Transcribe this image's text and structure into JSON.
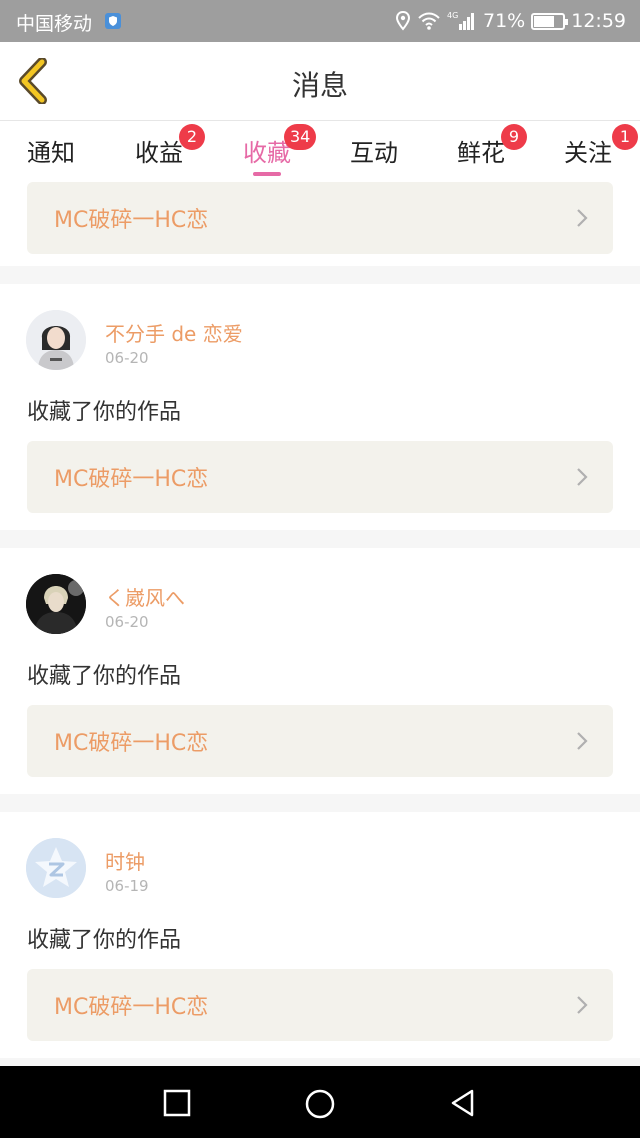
{
  "status_bar": {
    "carrier": "中国移动",
    "network": "4G",
    "battery": "71%",
    "battery_level": 0.71,
    "time": "12:59"
  },
  "header": {
    "title": "消息",
    "back_icon": "back-chevron-icon"
  },
  "tabs": [
    {
      "label": "通知",
      "badge": ""
    },
    {
      "label": "收益",
      "badge": "2"
    },
    {
      "label": "收藏",
      "badge": "34",
      "active": true
    },
    {
      "label": "互动",
      "badge": ""
    },
    {
      "label": "鲜花",
      "badge": "9"
    },
    {
      "label": "关注",
      "badge": "1"
    }
  ],
  "feed": {
    "top_partial_work": "MC破碎一HC恋",
    "items": [
      {
        "user": "不分手 de 恋爱",
        "date": "06-20",
        "action": "收藏了你的作品",
        "work": "MC破碎一HC恋"
      },
      {
        "user": "く崴风へ",
        "date": "06-20",
        "action": "收藏了你的作品",
        "work": "MC破碎一HC恋"
      },
      {
        "user": "时钟",
        "date": "06-19",
        "action": "收藏了你的作品",
        "work": "MC破碎一HC恋"
      }
    ]
  },
  "colors": {
    "accent": "#e66aa6",
    "badge": "#ee3b49",
    "username": "#ec9c66",
    "work_bg": "#f3f2ec"
  }
}
